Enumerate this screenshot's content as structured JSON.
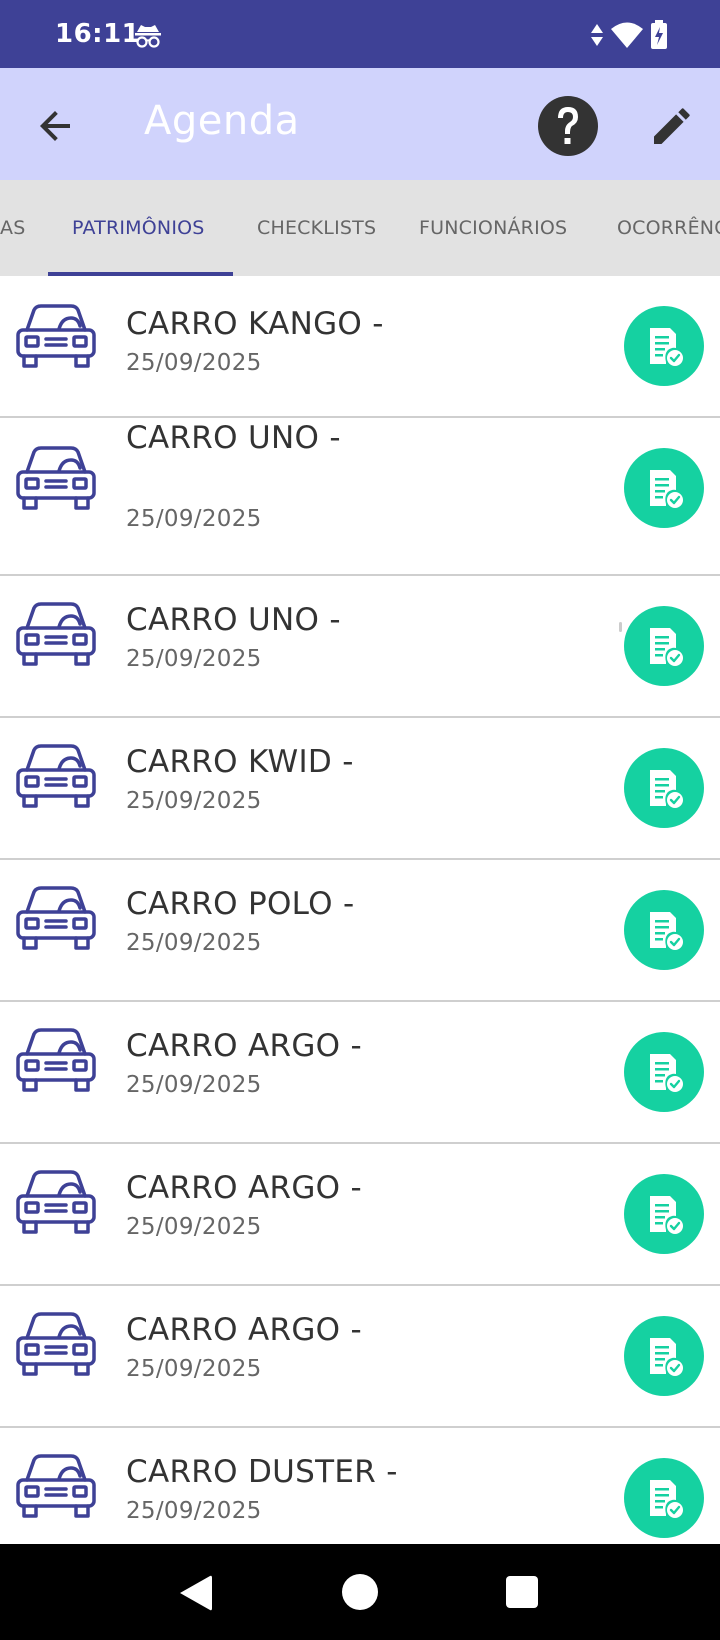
{
  "status_bar": {
    "time": "16:11",
    "icons": [
      "incognito-icon",
      "data-arrows-icon",
      "wifi-icon",
      "battery-charging-icon"
    ]
  },
  "app_bar": {
    "title": "Agenda",
    "back_icon": "arrow-left-icon",
    "help_icon": "help-circle-icon",
    "edit_icon": "pencil-icon"
  },
  "tabs": [
    {
      "label": "AS",
      "active": false
    },
    {
      "label": "PATRIMÔNIOS",
      "active": true
    },
    {
      "label": "CHECKLISTS",
      "active": false
    },
    {
      "label": "FUNCIONÁRIOS",
      "active": false
    },
    {
      "label": "OCORRÊNC",
      "active": false
    }
  ],
  "items": [
    {
      "title": "CARRO KANGO -",
      "date": "25/09/2025"
    },
    {
      "title": "CARRO UNO -",
      "date": "25/09/2025"
    },
    {
      "title": "CARRO UNO -",
      "date": "25/09/2025"
    },
    {
      "title": "CARRO KWID -",
      "date": "25/09/2025"
    },
    {
      "title": "CARRO POLO -",
      "date": "25/09/2025"
    },
    {
      "title": "CARRO ARGO -",
      "date": "25/09/2025"
    },
    {
      "title": "CARRO ARGO -",
      "date": "25/09/2025"
    },
    {
      "title": "CARRO ARGO -",
      "date": "25/09/2025"
    },
    {
      "title": "CARRO DUSTER -",
      "date": "25/09/2025"
    }
  ],
  "colors": {
    "primary": "#3e4196",
    "app_bar": "#d0d3fc",
    "tab_bar": "#e2e2e2",
    "action_button": "#15d1a1"
  },
  "nav_bar": {
    "icons": [
      "nav-back-icon",
      "nav-home-icon",
      "nav-recents-icon"
    ]
  }
}
